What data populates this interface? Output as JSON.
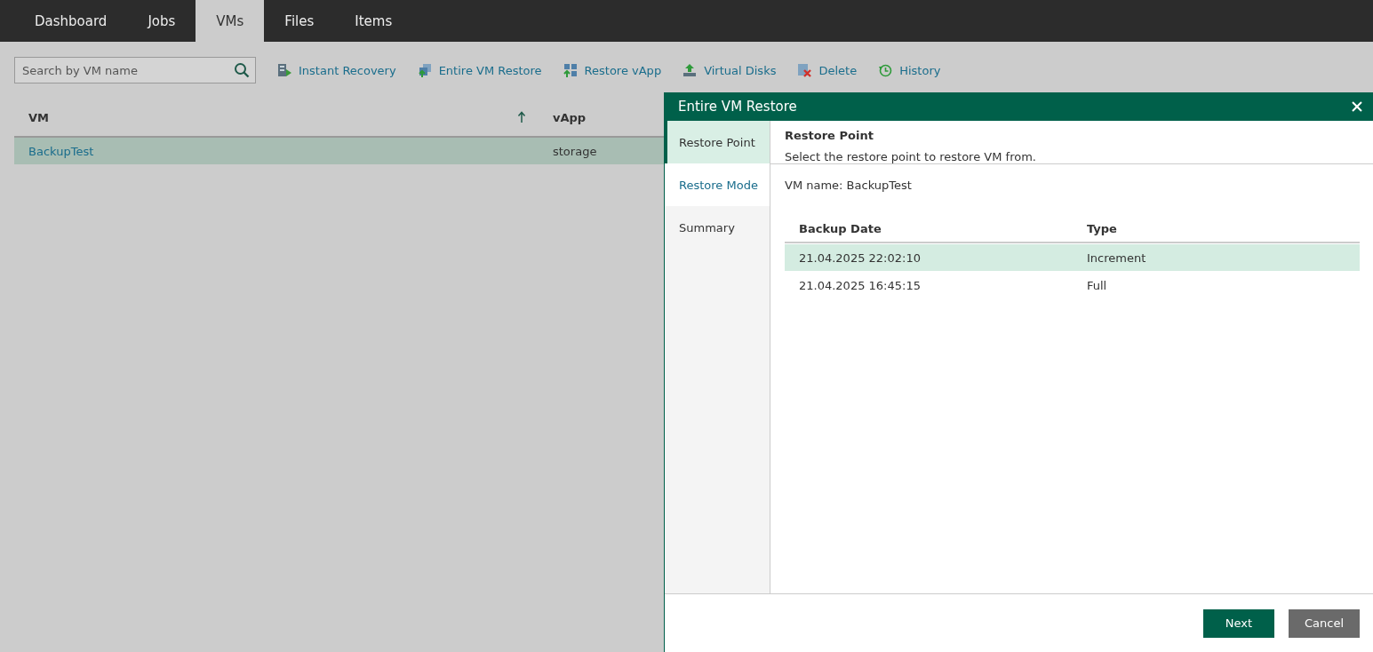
{
  "nav_tabs": [
    {
      "label": "Dashboard",
      "selected": false
    },
    {
      "label": "Jobs",
      "selected": false
    },
    {
      "label": "VMs",
      "selected": true
    },
    {
      "label": "Files",
      "selected": false
    },
    {
      "label": "Items",
      "selected": false
    }
  ],
  "search": {
    "placeholder": "Search by VM name"
  },
  "toolbar": [
    {
      "label": "Instant Recovery"
    },
    {
      "label": "Entire VM Restore"
    },
    {
      "label": "Restore vApp"
    },
    {
      "label": "Virtual Disks"
    },
    {
      "label": "Delete"
    },
    {
      "label": "History"
    }
  ],
  "vm_table": {
    "columns": [
      {
        "label": "VM",
        "sorted": true
      },
      {
        "label": "vApp",
        "sorted": false
      }
    ],
    "rows": [
      {
        "cells": [
          "BackupTest",
          "storage"
        ],
        "selected": true
      }
    ]
  },
  "dialog": {
    "title": "Entire VM Restore",
    "steps": [
      {
        "label": "Restore Point",
        "selected": true,
        "enabled": true
      },
      {
        "label": "Restore Mode",
        "selected": false,
        "enabled": true
      },
      {
        "label": "Summary",
        "selected": false,
        "enabled": false
      }
    ],
    "heading": "Restore Point",
    "description": "Select the restore point to restore VM from.",
    "vm_name": "VM name: BackupTest",
    "table": {
      "columns": [
        "Backup Date",
        "Type"
      ],
      "rows": [
        {
          "cells": [
            "21.04.2025 22:02:10",
            "Increment"
          ],
          "selected": true
        },
        {
          "cells": [
            "21.04.2025 16:45:15",
            "Full"
          ],
          "selected": false
        }
      ]
    },
    "buttons": [
      {
        "label": "Next",
        "kind": "primary"
      },
      {
        "label": "Cancel",
        "kind": "secondary"
      }
    ]
  }
}
